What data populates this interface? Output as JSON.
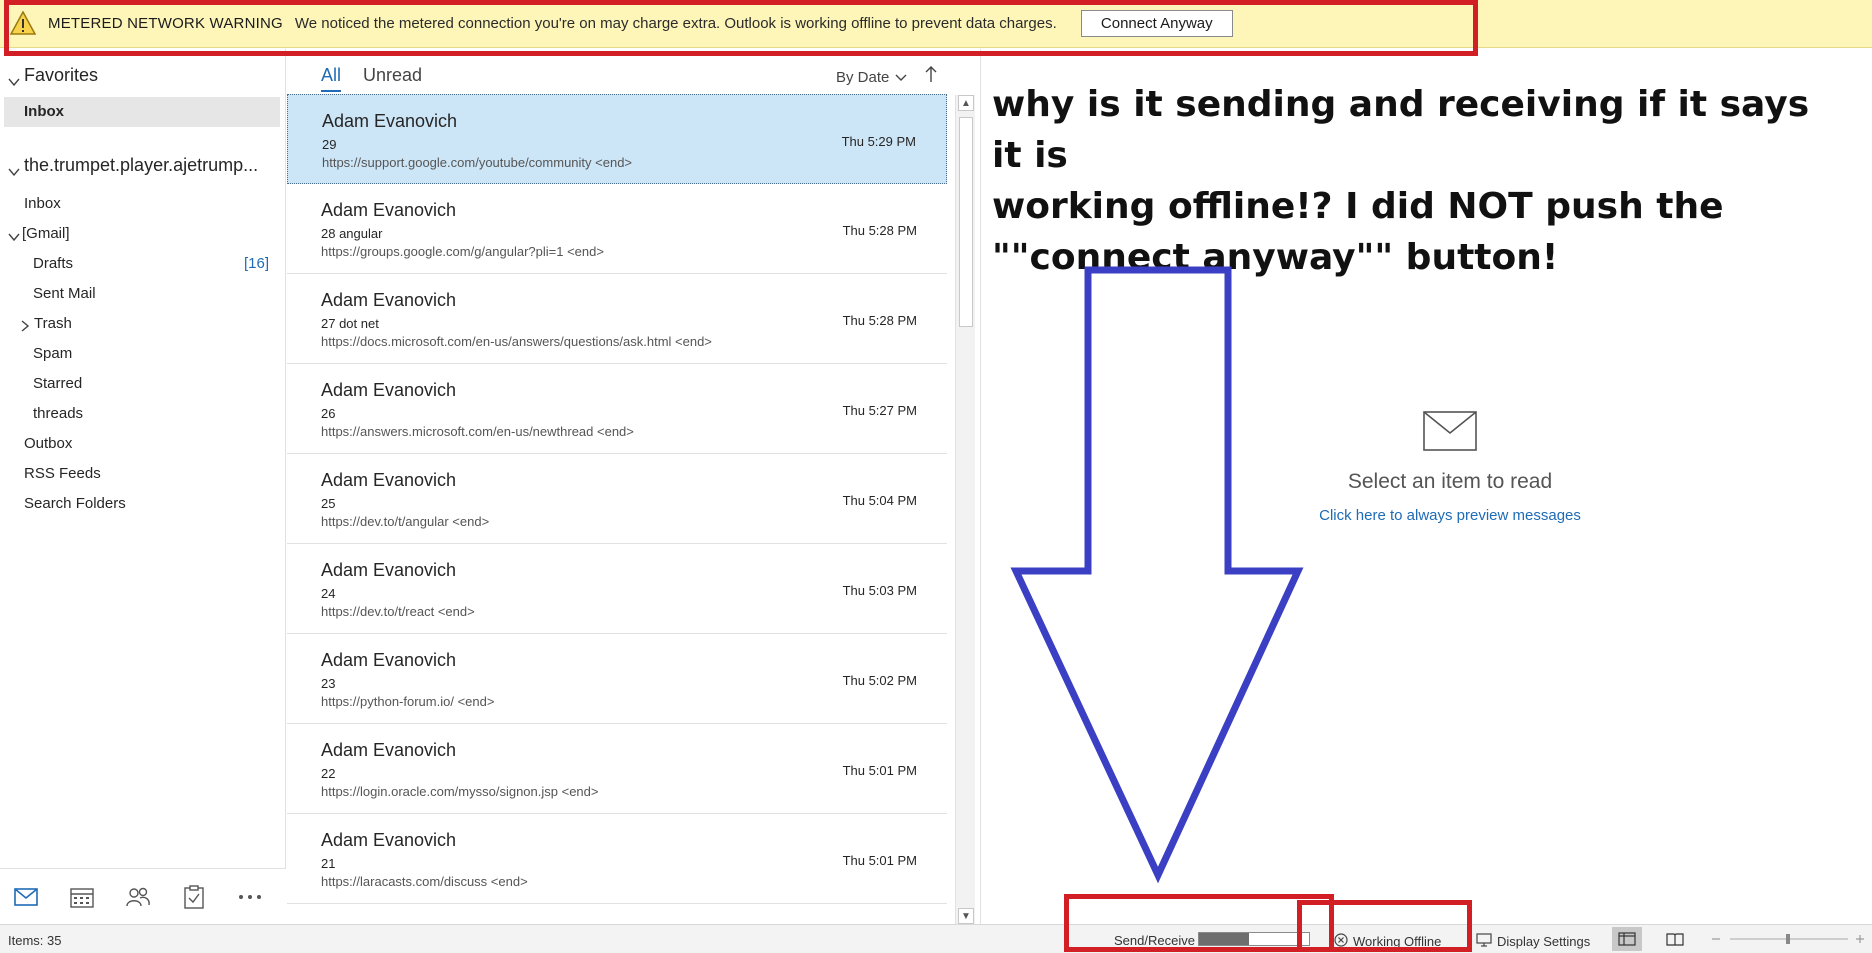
{
  "warning": {
    "title": "METERED NETWORK WARNING",
    "text": "We noticed the metered connection you're on may charge extra. Outlook is working offline to prevent data charges.",
    "button": "Connect Anyway"
  },
  "folders": {
    "favorites_label": "Favorites",
    "favorites_inbox": "Inbox",
    "account": "the.trumpet.player.ajetrump...",
    "items": [
      {
        "label": "Inbox"
      },
      {
        "label": "[Gmail]"
      },
      {
        "label": "Drafts",
        "count": "[16]"
      },
      {
        "label": "Sent Mail"
      },
      {
        "label": "Trash"
      },
      {
        "label": "Spam"
      },
      {
        "label": "Starred"
      },
      {
        "label": "threads"
      },
      {
        "label": "Outbox"
      },
      {
        "label": "RSS Feeds"
      },
      {
        "label": "Search Folders"
      }
    ]
  },
  "list": {
    "tab_all": "All",
    "tab_unread": "Unread",
    "sort_label": "By Date",
    "messages": [
      {
        "from": "Adam Evanovich",
        "subject": "29",
        "preview": "https://support.google.com/youtube/community <end>",
        "time": "Thu 5:29 PM"
      },
      {
        "from": "Adam Evanovich",
        "subject": "28 angular",
        "preview": "https://groups.google.com/g/angular?pli=1 <end>",
        "time": "Thu 5:28 PM"
      },
      {
        "from": "Adam Evanovich",
        "subject": "27 dot net",
        "preview": "https://docs.microsoft.com/en-us/answers/questions/ask.html <end>",
        "time": "Thu 5:28 PM"
      },
      {
        "from": "Adam Evanovich",
        "subject": "26",
        "preview": "https://answers.microsoft.com/en-us/newthread <end>",
        "time": "Thu 5:27 PM"
      },
      {
        "from": "Adam Evanovich",
        "subject": "25",
        "preview": "https://dev.to/t/angular <end>",
        "time": "Thu 5:04 PM"
      },
      {
        "from": "Adam Evanovich",
        "subject": "24",
        "preview": "https://dev.to/t/react <end>",
        "time": "Thu 5:03 PM"
      },
      {
        "from": "Adam Evanovich",
        "subject": "23",
        "preview": "https://python-forum.io/ <end>",
        "time": "Thu 5:02 PM"
      },
      {
        "from": "Adam Evanovich",
        "subject": "22",
        "preview": "https://login.oracle.com/mysso/signon.jsp <end>",
        "time": "Thu 5:01 PM"
      },
      {
        "from": "Adam Evanovich",
        "subject": "21",
        "preview": "https://laracasts.com/discuss <end>",
        "time": "Thu 5:01 PM"
      }
    ]
  },
  "reading": {
    "annotation_line1": "why is it sending and receiving if it says it is",
    "annotation_line2": "working offline!?  I did NOT push the",
    "annotation_line3": "\"\"connect anyway\"\" button!",
    "select_text": "Select an item to read",
    "preview_link": "Click here to always preview messages"
  },
  "status": {
    "items": "Items: 35",
    "send_receive": "Send/Receive",
    "progress_fraction": 0.45,
    "working_offline": "Working Offline",
    "display_settings": "Display Settings"
  },
  "colors": {
    "accent": "#1f6bb5",
    "selected_row": "#cde6f7",
    "warning_bg": "#fdf6b8",
    "annotation_red": "#d21f26",
    "annotation_blue": "#3b3fc4"
  }
}
